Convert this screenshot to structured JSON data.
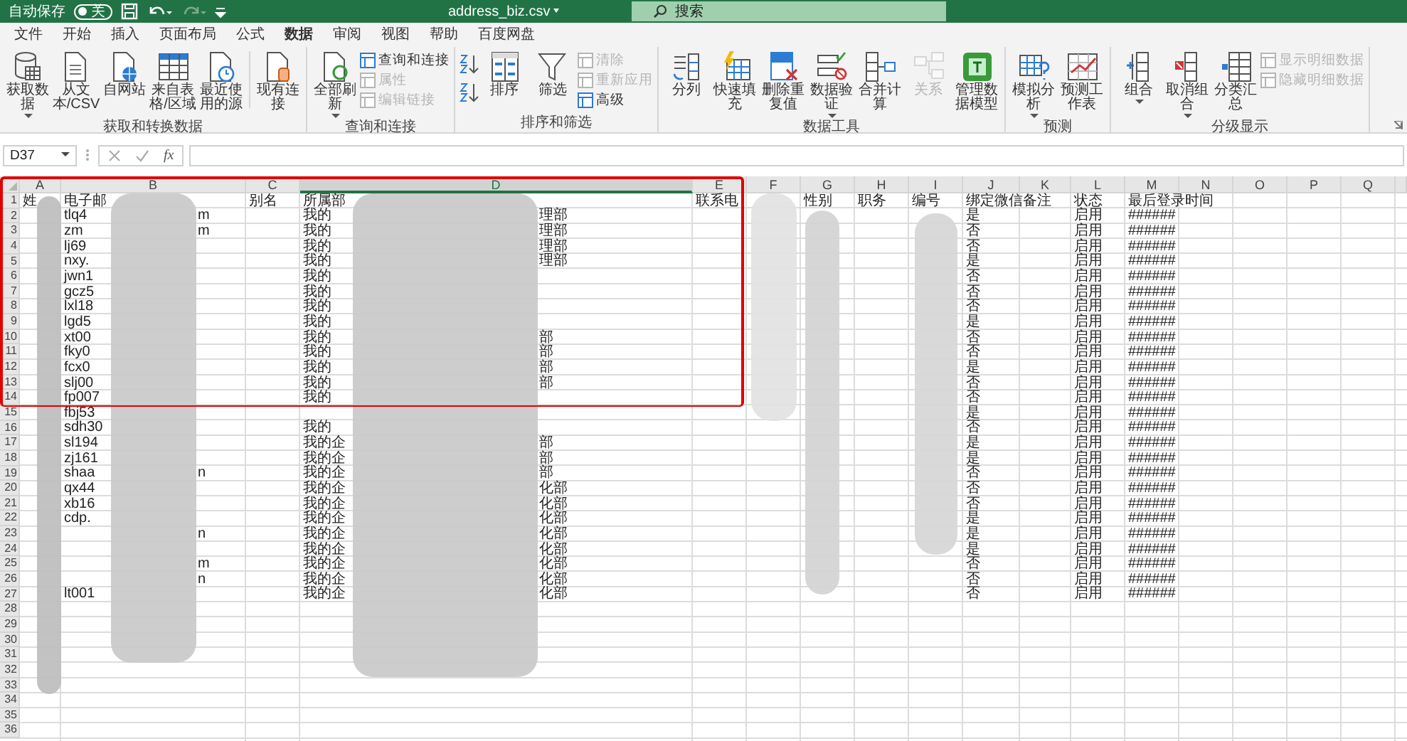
{
  "title_bar": {
    "autosave_label": "自动保存",
    "autosave_on": false,
    "toggle_text": "关",
    "file_name": "address_biz.csv",
    "search_placeholder": "搜索"
  },
  "menu_tabs": [
    {
      "label": "文件",
      "selected": false
    },
    {
      "label": "开始",
      "selected": false
    },
    {
      "label": "插入",
      "selected": false
    },
    {
      "label": "页面布局",
      "selected": false
    },
    {
      "label": "公式",
      "selected": false
    },
    {
      "label": "数据",
      "selected": true
    },
    {
      "label": "审阅",
      "selected": false
    },
    {
      "label": "视图",
      "selected": false
    },
    {
      "label": "帮助",
      "selected": false
    },
    {
      "label": "百度网盘",
      "selected": false
    }
  ],
  "ribbon_groups": [
    {
      "label": "获取和转换数据",
      "items": [
        {
          "kind": "large",
          "label": "获取数据",
          "dropdown": true,
          "disabled": false
        },
        {
          "kind": "large",
          "label": "从文本/CSV",
          "dropdown": false,
          "disabled": false
        },
        {
          "kind": "large",
          "label": "自网站",
          "dropdown": false,
          "disabled": false
        },
        {
          "kind": "large",
          "label": "来自表格/区域",
          "dropdown": false,
          "disabled": false
        },
        {
          "kind": "large",
          "label": "最近使用的源",
          "dropdown": false,
          "disabled": false
        },
        {
          "kind": "sep"
        },
        {
          "kind": "large",
          "label": "现有连接",
          "dropdown": false,
          "disabled": false
        }
      ]
    },
    {
      "label": "查询和连接",
      "items": [
        {
          "kind": "large",
          "label": "全部刷新",
          "dropdown": true,
          "disabled": false
        },
        {
          "kind": "stack",
          "items": [
            {
              "label": "查询和连接",
              "disabled": false
            },
            {
              "label": "属性",
              "disabled": true
            },
            {
              "label": "编辑链接",
              "disabled": true
            }
          ]
        }
      ]
    },
    {
      "label": "排序和筛选",
      "items": [
        {
          "kind": "sortpair"
        },
        {
          "kind": "large",
          "label": "排序",
          "dropdown": false,
          "disabled": false
        },
        {
          "kind": "large",
          "label": "筛选",
          "dropdown": false,
          "disabled": false
        },
        {
          "kind": "stack",
          "items": [
            {
              "label": "清除",
              "disabled": true
            },
            {
              "label": "重新应用",
              "disabled": true
            },
            {
              "label": "高级",
              "disabled": false
            }
          ]
        }
      ]
    },
    {
      "label": "数据工具",
      "items": [
        {
          "kind": "large",
          "label": "分列",
          "dropdown": false,
          "disabled": false
        },
        {
          "kind": "large",
          "label": "快速填充",
          "dropdown": false,
          "disabled": false
        },
        {
          "kind": "large",
          "label": "删除重复值",
          "dropdown": false,
          "disabled": false
        },
        {
          "kind": "large",
          "label": "数据验证",
          "dropdown": true,
          "disabled": false
        },
        {
          "kind": "large",
          "label": "合并计算",
          "dropdown": false,
          "disabled": false
        },
        {
          "kind": "large",
          "label": "关系",
          "dropdown": false,
          "disabled": true
        },
        {
          "kind": "large",
          "label": "管理数据模型",
          "dropdown": false,
          "disabled": false
        }
      ]
    },
    {
      "label": "预测",
      "items": [
        {
          "kind": "large",
          "label": "模拟分析",
          "dropdown": true,
          "disabled": false
        },
        {
          "kind": "large",
          "label": "预测工作表",
          "dropdown": false,
          "disabled": false
        }
      ]
    },
    {
      "label": "分级显示",
      "items": [
        {
          "kind": "large",
          "label": "组合",
          "dropdown": true,
          "disabled": false
        },
        {
          "kind": "large",
          "label": "取消组合",
          "dropdown": true,
          "disabled": false
        },
        {
          "kind": "large",
          "label": "分类汇总",
          "dropdown": false,
          "disabled": false
        },
        {
          "kind": "stack",
          "items": [
            {
              "label": "显示明细数据",
              "disabled": true
            },
            {
              "label": "隐藏明细数据",
              "disabled": true
            }
          ]
        }
      ]
    }
  ],
  "formula_bar": {
    "name_box": "D37",
    "function_label": "fx"
  },
  "columns": [
    {
      "label": "A",
      "selected": false
    },
    {
      "label": "B",
      "selected": false
    },
    {
      "label": "C",
      "selected": false
    },
    {
      "label": "D",
      "selected": true
    },
    {
      "label": "E",
      "selected": false
    },
    {
      "label": "F",
      "selected": false
    },
    {
      "label": "G",
      "selected": false
    },
    {
      "label": "H",
      "selected": false
    },
    {
      "label": "I",
      "selected": false
    },
    {
      "label": "J",
      "selected": false
    },
    {
      "label": "K",
      "selected": false
    },
    {
      "label": "L",
      "selected": false
    },
    {
      "label": "M",
      "selected": false
    },
    {
      "label": "N",
      "selected": false
    },
    {
      "label": "O",
      "selected": false
    },
    {
      "label": "P",
      "selected": false
    },
    {
      "label": "Q",
      "selected": false
    }
  ],
  "rows": [
    {
      "number": "1",
      "cells": {
        "A": "姓",
        "B": "电子邮",
        "C": "别名",
        "D": "所属部",
        "E": "联系电",
        "G": "性别",
        "H": "职务",
        "I": "编号",
        "J": "绑定微信",
        "K": "备注",
        "L": "状态",
        "M": "最后登录时间"
      }
    },
    {
      "number": "2",
      "cells": {
        "B": "tlq4",
        "B_tail": "m",
        "D": "我的",
        "D_tail": "理部",
        "J": "是",
        "L": "启用",
        "M": "######"
      }
    },
    {
      "number": "3",
      "cells": {
        "B": "zm",
        "B_tail": "m",
        "D": "我的",
        "D_tail": "理部",
        "J": "否",
        "L": "启用",
        "M": "######"
      }
    },
    {
      "number": "4",
      "cells": {
        "B": "lj69",
        "D": "我的",
        "D_tail": "理部",
        "J": "否",
        "L": "启用",
        "M": "######"
      }
    },
    {
      "number": "5",
      "cells": {
        "B": "nxy.",
        "D": "我的",
        "D_tail": "理部",
        "J": "是",
        "L": "启用",
        "M": "######"
      }
    },
    {
      "number": "6",
      "cells": {
        "B": "jwn1",
        "D": "我的",
        "J": "否",
        "L": "启用",
        "M": "######"
      }
    },
    {
      "number": "7",
      "cells": {
        "B": "gcz5",
        "D": "我的",
        "J": "否",
        "L": "启用",
        "M": "######"
      }
    },
    {
      "number": "8",
      "cells": {
        "B": "lxl18",
        "D": "我的",
        "J": "否",
        "L": "启用",
        "M": "######"
      }
    },
    {
      "number": "9",
      "cells": {
        "B": "lgd5",
        "D": "我的",
        "J": "是",
        "L": "启用",
        "M": "######"
      }
    },
    {
      "number": "10",
      "cells": {
        "B": "xt00",
        "D": "我的",
        "D_tail": "部",
        "J": "否",
        "L": "启用",
        "M": "######"
      }
    },
    {
      "number": "11",
      "cells": {
        "B": "fky0",
        "D": "我的",
        "D_tail": "部",
        "J": "否",
        "L": "启用",
        "M": "######"
      }
    },
    {
      "number": "12",
      "cells": {
        "B": "fcx0",
        "D": "我的",
        "D_tail": "部",
        "J": "是",
        "L": "启用",
        "M": "######"
      }
    },
    {
      "number": "13",
      "cells": {
        "B": "slj00",
        "D": "我的",
        "D_tail": "部",
        "J": "否",
        "L": "启用",
        "M": "######"
      }
    },
    {
      "number": "14",
      "cells": {
        "B": "fp007",
        "D": "我的",
        "J": "否",
        "L": "启用",
        "M": "######"
      }
    },
    {
      "number": "15",
      "cells": {
        "B": "fbj53",
        "J": "是",
        "L": "启用",
        "M": "######"
      }
    },
    {
      "number": "16",
      "cells": {
        "B": "sdh30",
        "D": "我的",
        "J": "否",
        "L": "启用",
        "M": "######"
      }
    },
    {
      "number": "17",
      "cells": {
        "B": "sl194",
        "D": "我的企",
        "D_tail": "部",
        "J": "是",
        "L": "启用",
        "M": "######"
      }
    },
    {
      "number": "18",
      "cells": {
        "B": "zj161",
        "D": "我的企",
        "D_tail": "部",
        "J": "是",
        "L": "启用",
        "M": "######"
      }
    },
    {
      "number": "19",
      "cells": {
        "B": "shaa",
        "B_tail": "n",
        "D": "我的企",
        "D_tail": "部",
        "J": "否",
        "L": "启用",
        "M": "######"
      }
    },
    {
      "number": "20",
      "cells": {
        "B": "qx44",
        "D": "我的企",
        "D_tail": "化部",
        "J": "否",
        "L": "启用",
        "M": "######"
      }
    },
    {
      "number": "21",
      "cells": {
        "B": "xb16",
        "D": "我的企",
        "D_tail": "化部",
        "J": "否",
        "L": "启用",
        "M": "######"
      }
    },
    {
      "number": "22",
      "cells": {
        "B": "cdp.",
        "D": "我的企",
        "D_tail": "化部",
        "J": "是",
        "L": "启用",
        "M": "######"
      }
    },
    {
      "number": "23",
      "cells": {
        "B_tail": "n",
        "D": "我的企",
        "D_tail": "化部",
        "J": "是",
        "L": "启用",
        "M": "######"
      }
    },
    {
      "number": "24",
      "cells": {
        "D": "我的企",
        "D_tail": "化部",
        "J": "是",
        "L": "启用",
        "M": "######"
      }
    },
    {
      "number": "25",
      "cells": {
        "B_tail": "m",
        "D": "我的企",
        "D_tail": "化部",
        "J": "否",
        "L": "启用",
        "M": "######"
      }
    },
    {
      "number": "26",
      "cells": {
        "B_tail": "n",
        "D": "我的企",
        "D_tail": "化部",
        "J": "否",
        "L": "启用",
        "M": "######"
      }
    },
    {
      "number": "27",
      "cells": {
        "B": "lt001",
        "D": "我的企",
        "D_tail": "化部",
        "J": "否",
        "L": "启用",
        "M": "######"
      }
    },
    {
      "number": "28",
      "cells": {}
    },
    {
      "number": "29",
      "cells": {}
    },
    {
      "number": "30",
      "cells": {}
    },
    {
      "number": "31",
      "cells": {}
    },
    {
      "number": "32",
      "cells": {}
    },
    {
      "number": "33",
      "cells": {}
    },
    {
      "number": "34",
      "cells": {}
    },
    {
      "number": "35",
      "cells": {}
    },
    {
      "number": "36",
      "cells": {}
    }
  ]
}
